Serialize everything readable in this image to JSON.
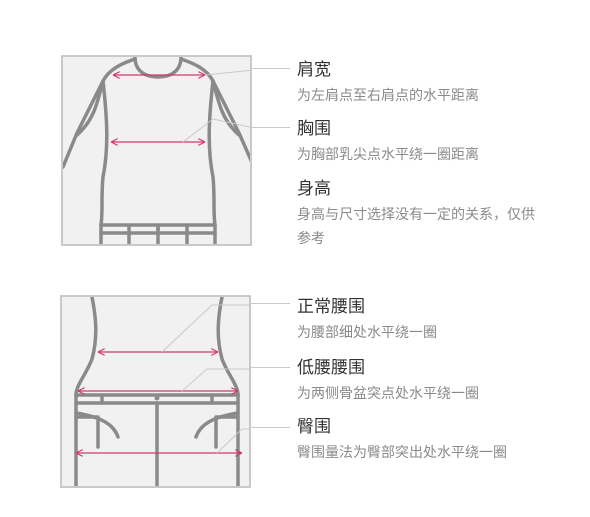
{
  "colors": {
    "outline": "#8a8a8a",
    "measure": "#d2396b",
    "panel_bg": "#f1f1f1",
    "border": "#c9c9c9"
  },
  "top_panel": {
    "illustration": "tshirt-icon",
    "items": [
      {
        "title": "肩宽",
        "desc": "为左肩点至右肩点的水平距离"
      },
      {
        "title": "胸围",
        "desc": "为胸部乳尖点水平绕一圈距离"
      },
      {
        "title": "身高",
        "desc": "身高与尺寸选择没有一定的关系，仅供参考"
      }
    ]
  },
  "bottom_panel": {
    "illustration": "pants-icon",
    "items": [
      {
        "title": "正常腰围",
        "desc": "为腰部细处水平绕一圈"
      },
      {
        "title": "低腰腰围",
        "desc": "为两侧骨盆突点处水平绕一圈"
      },
      {
        "title": "臀围",
        "desc": "臀围量法为臀部突出处水平绕一圈"
      }
    ]
  }
}
